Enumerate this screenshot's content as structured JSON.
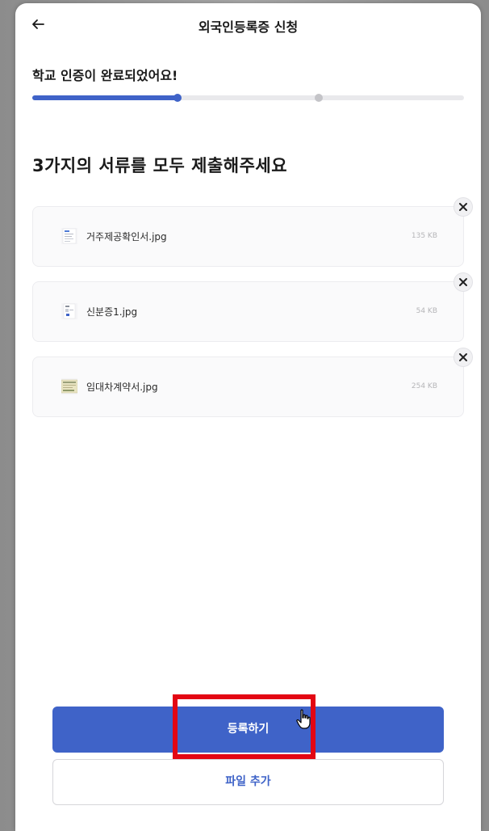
{
  "header": {
    "title": "외국인등록증 신청",
    "back_icon": "arrow-left-icon"
  },
  "progress": {
    "label": "학교 인증이 완료되었어요!",
    "fraction": 0.336,
    "steps": [
      0.336,
      0.664
    ],
    "colors": {
      "active": "#3f63c8",
      "inactive": "#c4c4c8",
      "track": "#e9e9ec"
    }
  },
  "main": {
    "headline": "3가지의 서류를 모두 제출해주세요"
  },
  "files": [
    {
      "name": "거주제공확인서.jpg",
      "size": "135 KB",
      "thumb_icon": "document-thumbnail-icon"
    },
    {
      "name": "신분증1.jpg",
      "size": "54 KB",
      "thumb_icon": "id-card-thumbnail-icon"
    },
    {
      "name": "임대차계약서.jpg",
      "size": "254 KB",
      "thumb_icon": "contract-thumbnail-icon"
    }
  ],
  "actions": {
    "register_label": "등록하기",
    "add_file_label": "파일 추가"
  },
  "colors": {
    "accent": "#3f63c8",
    "highlight": "#e30613"
  }
}
